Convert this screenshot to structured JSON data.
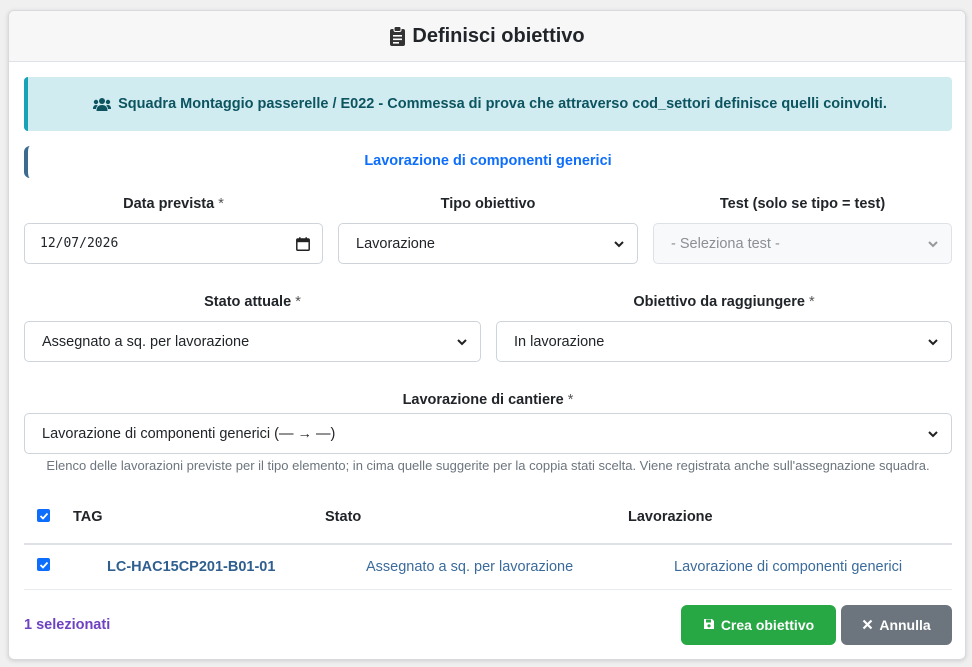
{
  "header": {
    "title": "Definisci obiettivo",
    "icon": "clipboard-icon"
  },
  "alert": {
    "icon": "users-icon",
    "text": "Squadra Montaggio passerelle / E022 - Commessa di prova che attraverso cod_settori definisce quelli coinvolti."
  },
  "section": {
    "title": "Lavorazione di componenti generici"
  },
  "fields": {
    "data_prevista": {
      "label": "Data prevista",
      "value": "12/07/2026"
    },
    "tipo_obiettivo": {
      "label": "Tipo obiettivo",
      "value": "Lavorazione"
    },
    "test": {
      "label": "Test (solo se tipo = test)",
      "value": "- Seleziona test -"
    },
    "stato_attuale": {
      "label": "Stato attuale",
      "value": "Assegnato a sq. per lavorazione"
    },
    "obiettivo": {
      "label": "Obiettivo da raggiungere",
      "value": "In lavorazione"
    },
    "lavorazione": {
      "label": "Lavorazione di cantiere",
      "value": "Lavorazione di componenti generici (— → —)"
    },
    "required_mark": "*"
  },
  "help_text": "Elenco delle lavorazioni previste per il tipo elemento; in cima quelle suggerite per la coppia stati scelta. Viene registrata anche sull'assegnazione squadra.",
  "table": {
    "headers": [
      "TAG",
      "Stato",
      "Lavorazione"
    ],
    "rows": [
      {
        "tag": "LC-HAC15CP201-B01-01",
        "stato": "Assegnato a sq. per lavorazione",
        "lavorazione": "Lavorazione di componenti generici",
        "checked": true
      }
    ]
  },
  "footer": {
    "selected_count": "1 selezionati",
    "create_label": "Crea obiettivo",
    "cancel_label": "Annulla"
  },
  "colors": {
    "primary": "#0d6efd",
    "success": "#28a745",
    "secondary": "#6c757d",
    "info_bg": "#d1ecf1",
    "info_border": "#17a2b8",
    "purple": "#6f42c1"
  }
}
